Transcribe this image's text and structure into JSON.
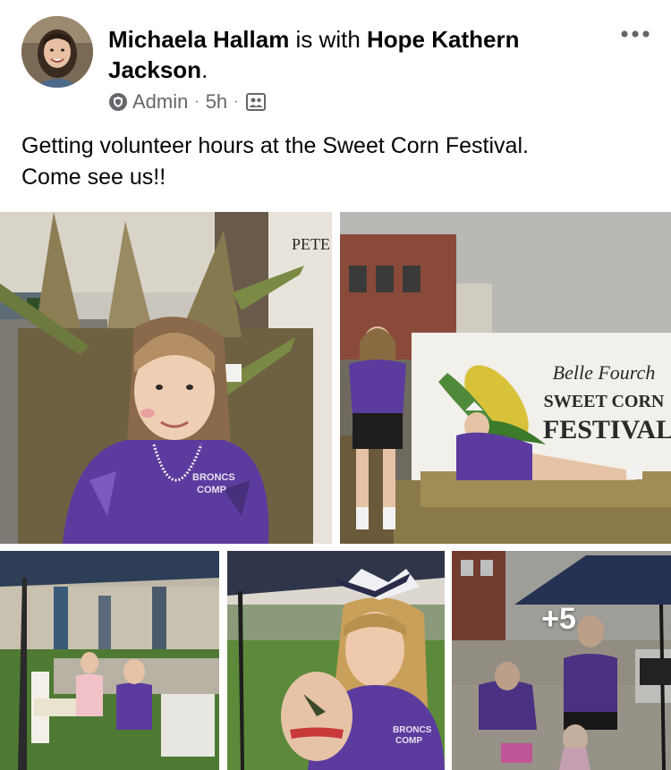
{
  "post": {
    "author": "Michaela Hallam",
    "with_text": " is with ",
    "tagged": "Hope Kathern Jackson",
    "period": ".",
    "role": "Admin",
    "time": "5h",
    "separator": "·",
    "text_line1": "Getting volunteer hours at the Sweet Corn Festival.",
    "text_line2": "Come see us!!"
  },
  "icons": {
    "more": "more-horizontal-icon",
    "badge": "admin-shield-icon",
    "audience": "group-audience-icon"
  },
  "photos": {
    "count_overlay": "+5",
    "sign_line1": "Belle Fourch",
    "sign_line2": "SWEET CORN",
    "sign_line3": "FESTIVAL",
    "shirt_text1": "BRONCS",
    "shirt_text2": "COMP",
    "store_sign": "PETE"
  },
  "colors": {
    "text_primary": "#050505",
    "text_secondary": "#65676b",
    "shirt_purple": "#5b3c9e"
  }
}
